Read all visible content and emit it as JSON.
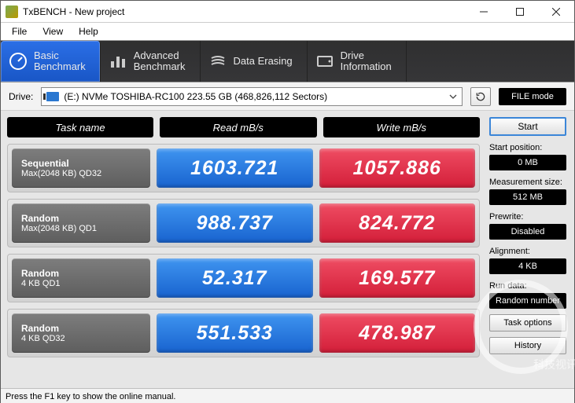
{
  "window": {
    "title": "TxBENCH - New project"
  },
  "menu": {
    "file": "File",
    "view": "View",
    "help": "Help"
  },
  "ribbon": {
    "basic": "Basic\nBenchmark",
    "advanced": "Advanced\nBenchmark",
    "erase": "Data Erasing",
    "drive": "Drive\nInformation"
  },
  "drive": {
    "label": "Drive:",
    "selected": "(E:) NVMe TOSHIBA-RC100  223.55 GB (468,826,112 Sectors)",
    "file_mode": "FILE mode"
  },
  "headers": {
    "task": "Task name",
    "read": "Read mB/s",
    "write": "Write mB/s"
  },
  "rows": [
    {
      "name": "Sequential",
      "sub": "Max(2048 KB) QD32",
      "read": "1603.721",
      "write": "1057.886"
    },
    {
      "name": "Random",
      "sub": "Max(2048 KB) QD1",
      "read": "988.737",
      "write": "824.772"
    },
    {
      "name": "Random",
      "sub": "4 KB QD1",
      "read": "52.317",
      "write": "169.577"
    },
    {
      "name": "Random",
      "sub": "4 KB QD32",
      "read": "551.533",
      "write": "478.987"
    }
  ],
  "side": {
    "start": "Start",
    "start_pos_label": "Start position:",
    "start_pos": "0 MB",
    "meas_label": "Measurement size:",
    "meas": "512 MB",
    "prewrite_label": "Prewrite:",
    "prewrite": "Disabled",
    "align_label": "Alignment:",
    "align": "4 KB",
    "data_label": "Run data:",
    "data": "Random number",
    "task_options": "Task options",
    "history": "History"
  },
  "status": "Press the F1 key to show the online manual.",
  "watermark": "科技视讯"
}
